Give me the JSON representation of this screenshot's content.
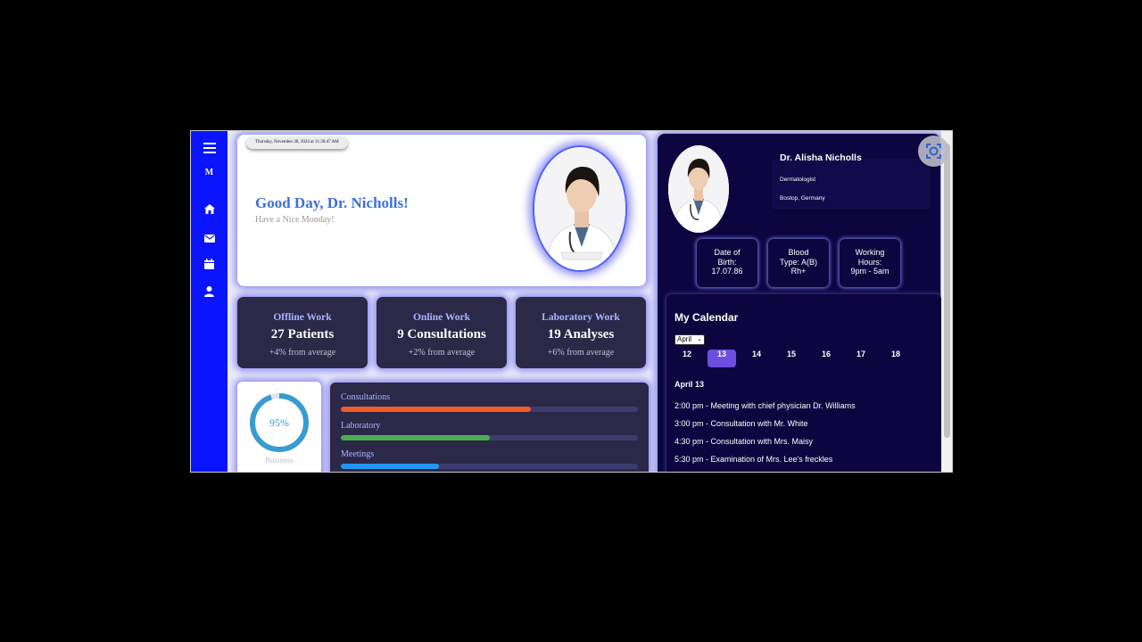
{
  "sidebar": {
    "logo_letter": "M",
    "icons": [
      "menu-icon",
      "home-icon",
      "mail-icon",
      "calendar-icon",
      "user-icon"
    ]
  },
  "hero": {
    "datetime": "Thursday, November 28, 2024 at 11:36:47 AM",
    "greeting": "Good Day, Dr. Nicholls!",
    "subtitle": "Have a Nice Monday!"
  },
  "stats": [
    {
      "title": "Offline Work",
      "value": "27 Patients",
      "change": "+4% from average"
    },
    {
      "title": "Online Work",
      "value": "9 Consultations",
      "change": "+2% from average"
    },
    {
      "title": "Laboratory Work",
      "value": "19 Analyses",
      "change": "+6% from average"
    }
  ],
  "gauge": {
    "value_label": "95%",
    "label": "Business",
    "fraction": 0.95,
    "color": "#3a9bd0"
  },
  "progress": [
    {
      "label": "Consultations",
      "fraction": 0.64,
      "color": "#f05a2a"
    },
    {
      "label": "Laboratory",
      "fraction": 0.5,
      "color": "#4caf50"
    },
    {
      "label": "Meetings",
      "fraction": 0.33,
      "color": "#2196f3"
    }
  ],
  "profile": {
    "name": "Dr. Alisha Nicholls",
    "specialty": "Dermatologist",
    "location": "Bostop, Germany"
  },
  "info_cards": [
    {
      "line1": "Date of",
      "line2": "Birth:",
      "line3": "17.07.86"
    },
    {
      "line1": "Blood",
      "line2": "Type: A(B)",
      "line3": "Rh+"
    },
    {
      "line1": "Working",
      "line2": "Hours:",
      "line3": "9pm - 5am"
    }
  ],
  "calendar": {
    "title": "My Calendar",
    "month": "April",
    "days": [
      "12",
      "13",
      "14",
      "15",
      "16",
      "17",
      "18"
    ],
    "selected_day": "13",
    "events_date": "April 13",
    "events": [
      "2:00 pm - Meeting with chief physician Dr. Williams",
      "3:00 pm - Consultation with Mr. White",
      "4:30 pm - Consultation with Mrs. Maisy",
      "5:30 pm - Examination of Mrs. Lee's freckles"
    ]
  },
  "colors": {
    "sidebar": "#0a14ff",
    "accent": "#3d6fdc",
    "panel": "#0d0540",
    "card": "#2b2848"
  }
}
